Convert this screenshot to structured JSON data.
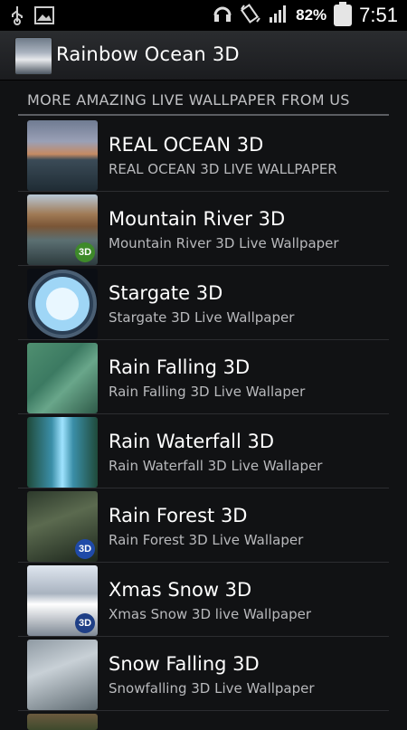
{
  "status_bar": {
    "battery_percent": "82%",
    "time": "7:51",
    "icons": [
      "usb-icon",
      "image-icon",
      "headset-icon",
      "rotate-icon",
      "signal-icon",
      "battery-icon"
    ]
  },
  "app": {
    "title": "Rainbow Ocean 3D"
  },
  "section": {
    "header": "MORE AMAZING LIVE WALLPAPER FROM US"
  },
  "items": [
    {
      "title": "REAL OCEAN 3D",
      "subtitle": "REAL OCEAN 3D LIVE WALLPAPER"
    },
    {
      "title": "Mountain River 3D",
      "subtitle": "Mountain River 3D Live Wallpaper",
      "badge": "3D"
    },
    {
      "title": "Stargate 3D",
      "subtitle": "Stargate 3D Live Wallpaper"
    },
    {
      "title": "Rain Falling 3D",
      "subtitle": "Rain Falling 3D Live Wallaper"
    },
    {
      "title": "Rain Waterfall 3D",
      "subtitle": "Rain Waterfall 3D Live Wallaper"
    },
    {
      "title": "Rain Forest 3D",
      "subtitle": "Rain Forest 3D Live Wallaper",
      "badge": "3D"
    },
    {
      "title": "Xmas Snow 3D",
      "subtitle": "Xmas Snow 3D live Wallpaper",
      "badge": "3D"
    },
    {
      "title": "Snow Falling 3D",
      "subtitle": "Snowfalling 3D Live Wallpaper"
    }
  ],
  "colors": {
    "background": "#111214",
    "divider": "#5b5d62",
    "subtitle": "#b8b9bc"
  }
}
